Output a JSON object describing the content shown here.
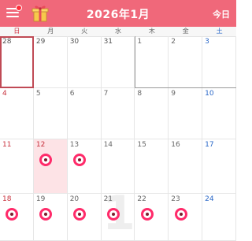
{
  "header": {
    "title": "2026年1月",
    "today_label": "今日",
    "colors": {
      "header_bg": "#f0687a",
      "mark": "#ff2b6a",
      "today_bg": "#fde3e6"
    }
  },
  "weekdays": [
    "日",
    "月",
    "火",
    "水",
    "木",
    "金",
    "土"
  ],
  "watermark": "1",
  "weeks": [
    [
      {
        "day": "28",
        "other": true,
        "selected": true
      },
      {
        "day": "29",
        "other": true
      },
      {
        "day": "30",
        "other": true
      },
      {
        "day": "31",
        "other": true
      },
      {
        "day": "1"
      },
      {
        "day": "2"
      },
      {
        "day": "3"
      }
    ],
    [
      {
        "day": "4"
      },
      {
        "day": "5"
      },
      {
        "day": "6"
      },
      {
        "day": "7"
      },
      {
        "day": "8"
      },
      {
        "day": "9"
      },
      {
        "day": "10"
      }
    ],
    [
      {
        "day": "11"
      },
      {
        "day": "12",
        "today": true,
        "mark": true
      },
      {
        "day": "13",
        "mark": true
      },
      {
        "day": "14"
      },
      {
        "day": "15"
      },
      {
        "day": "16"
      },
      {
        "day": "17"
      }
    ],
    [
      {
        "day": "18",
        "mark": true
      },
      {
        "day": "19",
        "mark": true
      },
      {
        "day": "20",
        "mark": true
      },
      {
        "day": "21",
        "mark": true
      },
      {
        "day": "22",
        "mark": true
      },
      {
        "day": "23",
        "mark": true
      },
      {
        "day": "24"
      }
    ]
  ]
}
